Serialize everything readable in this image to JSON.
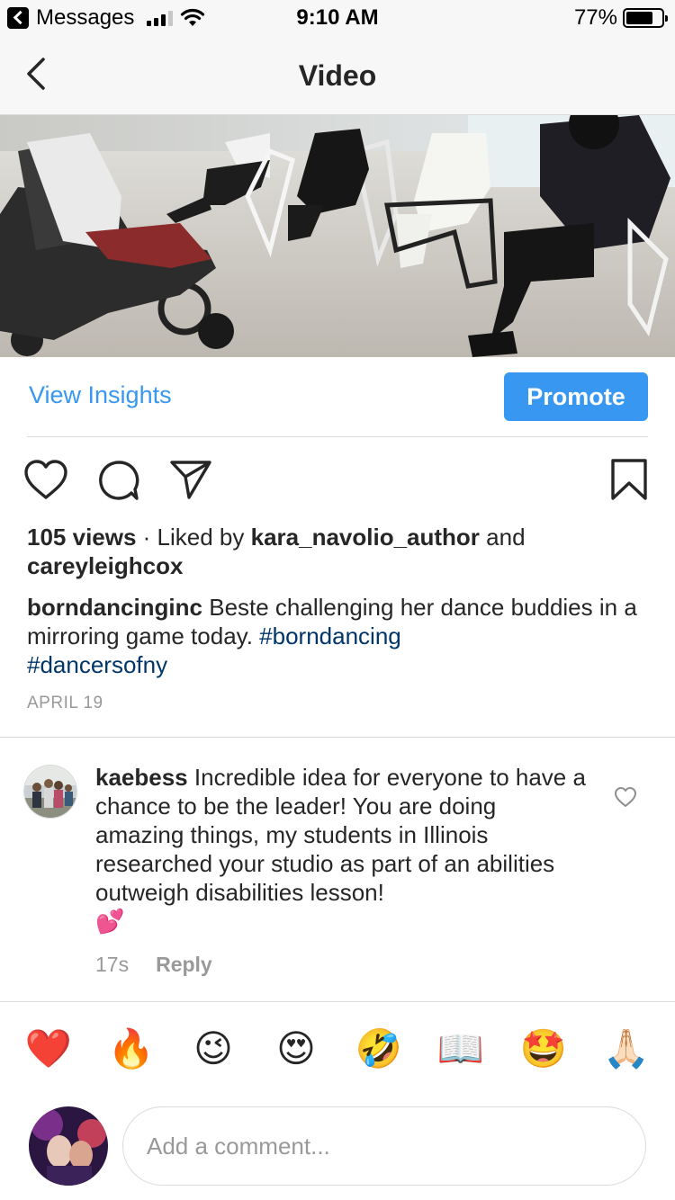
{
  "status_bar": {
    "back_app": "Messages",
    "time": "9:10 AM",
    "battery": "77%",
    "battery_level": 0.77
  },
  "nav": {
    "title": "Video"
  },
  "insights": {
    "view_insights": "View Insights",
    "promote": "Promote"
  },
  "post": {
    "views": "105 views",
    "liked_by_prefix": " · Liked by ",
    "liker1": "kara_navolio_author",
    "and": " and",
    "liker2": "careyleighcox",
    "caption_user": "borndancinginc",
    "caption_text": " Beste challenging her dance buddies in a mirroring game today. ",
    "hashtag1": "#borndancing",
    "hashtag2": "#dancersofny",
    "date": "APRIL 19"
  },
  "comment": {
    "user": "kaebess",
    "text": " Incredible idea for everyone to have a chance to be the leader!  You are doing amazing things, my students in Illinois researched your studio as part of an abilities outweigh disabilities lesson!",
    "emoji": "💕",
    "time": "17s",
    "reply": "Reply"
  },
  "quick_reactions": [
    "❤️",
    "🔥",
    "😉",
    "😍",
    "🤣",
    "📖",
    "🤩",
    "🙏🏻"
  ],
  "composer": {
    "placeholder": "Add a comment..."
  },
  "colors": {
    "accent": "#3897f0",
    "hashtag": "#003569",
    "muted": "#999999",
    "divider": "#dbdbdb"
  }
}
